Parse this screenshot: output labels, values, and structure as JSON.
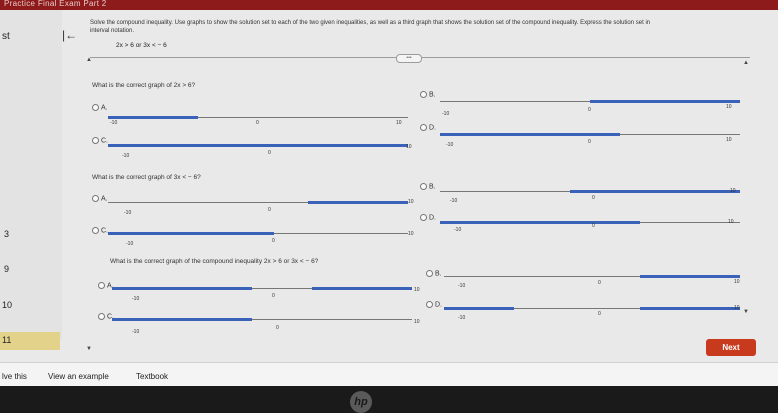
{
  "titlebar": {
    "text": "Practice Final Exam Part 2"
  },
  "left": {
    "nav_label": "st",
    "items": [
      "3",
      "9",
      "10",
      "11"
    ],
    "back_arrow": "|←"
  },
  "header": {
    "instructions": "Solve the compound inequality. Use graphs to show the solution set to each of the two given inequalities, as well as a third graph that shows the solution set of the compound inequality. Express the solution set in",
    "instructions2": "interval notation.",
    "given": "2x > 6 or 3x < − 6",
    "more": "•••"
  },
  "questions": [
    {
      "prompt": "What is the correct graph of 2x > 6?",
      "options": [
        {
          "letter": "A.",
          "ticks": {
            "left": "-10",
            "mid": "0",
            "right": "10"
          }
        },
        {
          "letter": "B.",
          "ticks": {
            "left": "-10",
            "mid": "0",
            "right": "10"
          }
        },
        {
          "letter": "C.",
          "ticks": {
            "left": "-10",
            "mid": "0",
            "right": "10"
          }
        },
        {
          "letter": "D.",
          "ticks": {
            "left": "-10",
            "mid": "0",
            "right": "10"
          }
        }
      ]
    },
    {
      "prompt": "What is the correct graph of 3x < − 6?",
      "options": [
        {
          "letter": "A.",
          "ticks": {
            "left": "-10",
            "mid": "0",
            "right": "10"
          }
        },
        {
          "letter": "B.",
          "ticks": {
            "left": "-10",
            "mid": "0",
            "right": "10"
          }
        },
        {
          "letter": "C.",
          "ticks": {
            "left": "-10",
            "mid": "0",
            "right": "10"
          }
        },
        {
          "letter": "D.",
          "ticks": {
            "left": "-10",
            "mid": "0",
            "right": "10"
          }
        }
      ]
    },
    {
      "prompt": "What is the correct graph of the compound inequality 2x > 6 or 3x < − 6?",
      "options": [
        {
          "letter": "A.",
          "ticks": {
            "left": "-10",
            "mid": "0",
            "right": "10"
          }
        },
        {
          "letter": "B.",
          "ticks": {
            "left": "-10",
            "mid": "0",
            "right": "10"
          }
        },
        {
          "letter": "C.",
          "ticks": {
            "left": "-10",
            "mid": "0",
            "right": "10"
          }
        },
        {
          "letter": "D.",
          "ticks": {
            "left": "-10",
            "mid": "0",
            "right": "10"
          }
        }
      ]
    }
  ],
  "footer": {
    "next": "Next",
    "links": [
      "lve this",
      "View an example",
      "Textbook"
    ]
  },
  "brand": {
    "hp": "hp"
  },
  "colors": {
    "accent": "#c73a1e",
    "line": "#3a62b8",
    "titlebar": "#8e1b1b"
  }
}
